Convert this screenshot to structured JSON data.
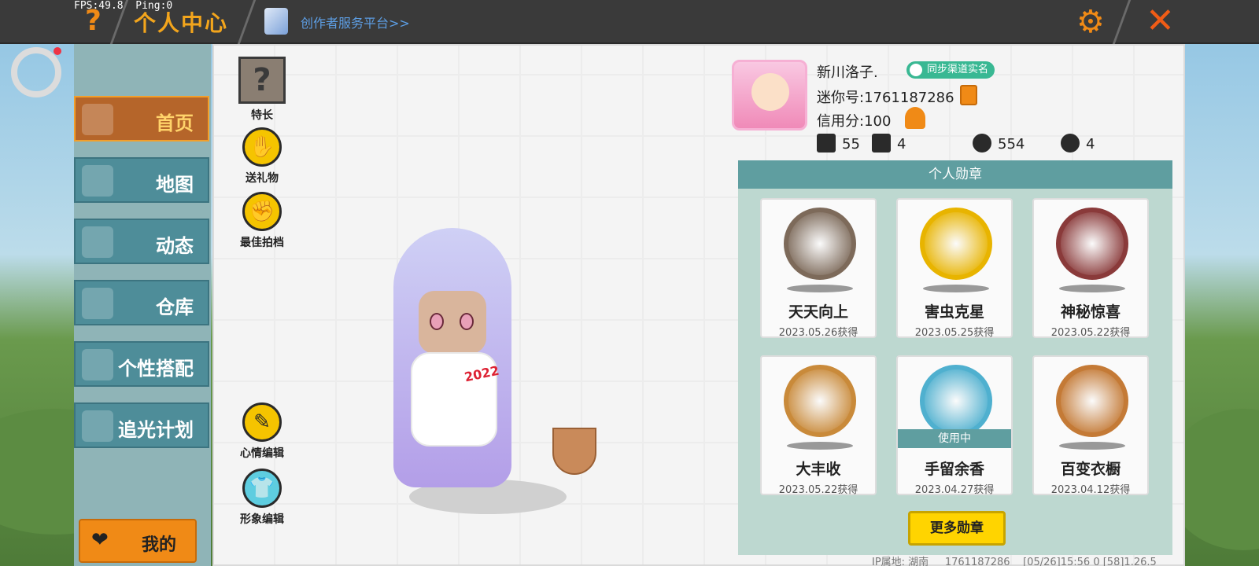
{
  "debug": {
    "fps": "FPS:49.8",
    "ping": "Ping:0"
  },
  "header": {
    "title": "个人中心",
    "creator_link": "创作者服务平台>>",
    "help_icon": "question-icon",
    "settings_icon": "gear-icon",
    "close_icon": "close-icon"
  },
  "sidebar": {
    "items": [
      {
        "label": "首页",
        "icon": "home-icon",
        "active": true
      },
      {
        "label": "地图",
        "icon": "map-icon",
        "active": false
      },
      {
        "label": "动态",
        "icon": "bell-icon",
        "active": false
      },
      {
        "label": "仓库",
        "icon": "warehouse-icon",
        "active": false
      },
      {
        "label": "个性搭配",
        "icon": "outfit-icon",
        "active": false
      },
      {
        "label": "追光计划",
        "icon": "notebook-icon",
        "active": false
      }
    ],
    "mine_label": "我的"
  },
  "actions": {
    "specialty": "特长",
    "gift": "送礼物",
    "best_partner": "最佳拍档",
    "mood_edit": "心情编辑",
    "avatar_edit": "形象编辑"
  },
  "avatar": {
    "badge_text": "2022"
  },
  "profile": {
    "nickname": "新川洛子.",
    "realname_badge": "同步渠道实名",
    "mini_id": "迷你号:1761187286",
    "credit": "信用分:100",
    "stats": {
      "posts": "55",
      "fans": "4",
      "popularity": "554",
      "likes": "4"
    }
  },
  "medals": {
    "header": "个人勋章",
    "items": [
      {
        "name": "天天向上",
        "date": "2023.05.26获得",
        "color": "#7d6a5a",
        "in_use": false
      },
      {
        "name": "害虫克星",
        "date": "2023.05.25获得",
        "color": "#e8b400",
        "in_use": false
      },
      {
        "name": "神秘惊喜",
        "date": "2023.05.22获得",
        "color": "#8a3a3a",
        "in_use": false
      },
      {
        "name": "大丰收",
        "date": "2023.05.22获得",
        "color": "#c98a3a",
        "in_use": false
      },
      {
        "name": "手留余香",
        "date": "2023.04.27获得",
        "color": "#4fb0cf",
        "in_use": true,
        "in_use_label": "使用中"
      },
      {
        "name": "百变衣橱",
        "date": "2023.04.12获得",
        "color": "#c47a36",
        "in_use": false
      }
    ],
    "more_button": "更多勋章"
  },
  "footer": {
    "ip_location": "IP属地: 湖南",
    "uid": "1761187286",
    "timestamp": "[05/26]15:56 0",
    "version": "[58]1.26.5"
  }
}
